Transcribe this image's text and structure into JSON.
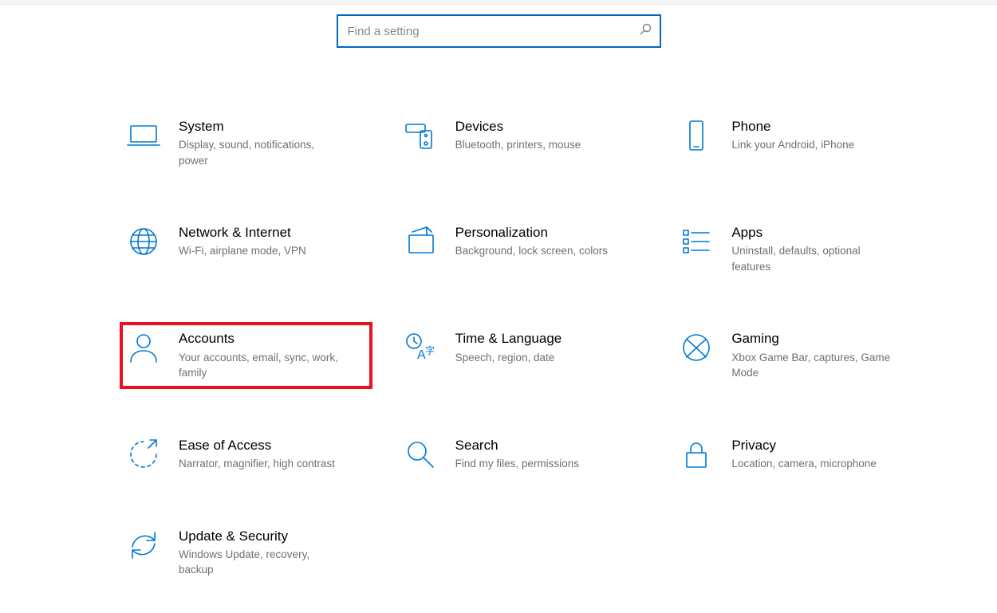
{
  "search": {
    "placeholder": "Find a setting"
  },
  "tiles": [
    {
      "title": "System",
      "desc": "Display, sound, notifications, power"
    },
    {
      "title": "Devices",
      "desc": "Bluetooth, printers, mouse"
    },
    {
      "title": "Phone",
      "desc": "Link your Android, iPhone"
    },
    {
      "title": "Network & Internet",
      "desc": "Wi-Fi, airplane mode, VPN"
    },
    {
      "title": "Personalization",
      "desc": "Background, lock screen, colors"
    },
    {
      "title": "Apps",
      "desc": "Uninstall, defaults, optional features"
    },
    {
      "title": "Accounts",
      "desc": "Your accounts, email, sync, work, family"
    },
    {
      "title": "Time & Language",
      "desc": "Speech, region, date"
    },
    {
      "title": "Gaming",
      "desc": "Xbox Game Bar, captures, Game Mode"
    },
    {
      "title": "Ease of Access",
      "desc": "Narrator, magnifier, high contrast"
    },
    {
      "title": "Search",
      "desc": "Find my files, permissions"
    },
    {
      "title": "Privacy",
      "desc": "Location, camera, microphone"
    },
    {
      "title": "Update & Security",
      "desc": "Windows Update, recovery, backup"
    }
  ],
  "highlightedIndex": 6
}
